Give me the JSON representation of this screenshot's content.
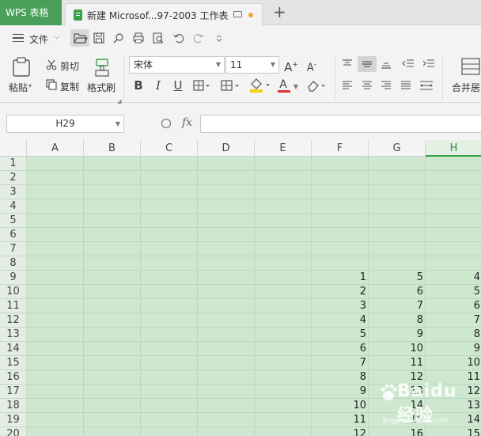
{
  "tabbar": {
    "app_tab": "WPS 表格",
    "doc_tab": "新建 Microsof...97-2003 工作表",
    "add_tab": "+"
  },
  "quickbar": {
    "file_label": "文件"
  },
  "ribbon": {
    "paste_label": "粘贴",
    "cut_label": "剪切",
    "copy_label": "复制",
    "format_painter_label": "格式刷",
    "font_name": "宋体",
    "font_size": "11",
    "bold": "B",
    "italic": "I",
    "underline": "U",
    "font_color_glyph": "A",
    "merge_label": "合并居"
  },
  "formula_bar": {
    "cell_ref": "H29",
    "fx": "fx",
    "formula": ""
  },
  "sheet": {
    "columns": [
      "A",
      "B",
      "C",
      "D",
      "E",
      "F",
      "G",
      "H"
    ],
    "active_column": "H",
    "rows": [
      "1",
      "2",
      "3",
      "4",
      "5",
      "6",
      "7",
      "8",
      "9",
      "10",
      "11",
      "12",
      "13",
      "14",
      "15",
      "16",
      "17",
      "18",
      "19",
      "20"
    ],
    "col_f": [
      "",
      "",
      "",
      "",
      "",
      "",
      "",
      "",
      "1",
      "2",
      "3",
      "4",
      "5",
      "6",
      "7",
      "8",
      "9",
      "10",
      "11",
      "12"
    ],
    "col_g": [
      "",
      "",
      "",
      "",
      "",
      "",
      "",
      "",
      "5",
      "6",
      "7",
      "8",
      "9",
      "10",
      "11",
      "12",
      "13",
      "14",
      "15",
      "16"
    ],
    "col_h": [
      "",
      "",
      "",
      "",
      "",
      "",
      "",
      "",
      "4",
      "5",
      "6",
      "7",
      "8",
      "9",
      "10",
      "11",
      "12",
      "13",
      "14",
      "15"
    ]
  },
  "watermark": {
    "text": "Baidu 经验",
    "sub": "jingyan.baidu.com"
  },
  "colors": {
    "accent": "#4aa05a",
    "grid_fill": "#cde8cf",
    "font_color_bar": "#e03030",
    "highlight_bar": "#f2d11a"
  }
}
